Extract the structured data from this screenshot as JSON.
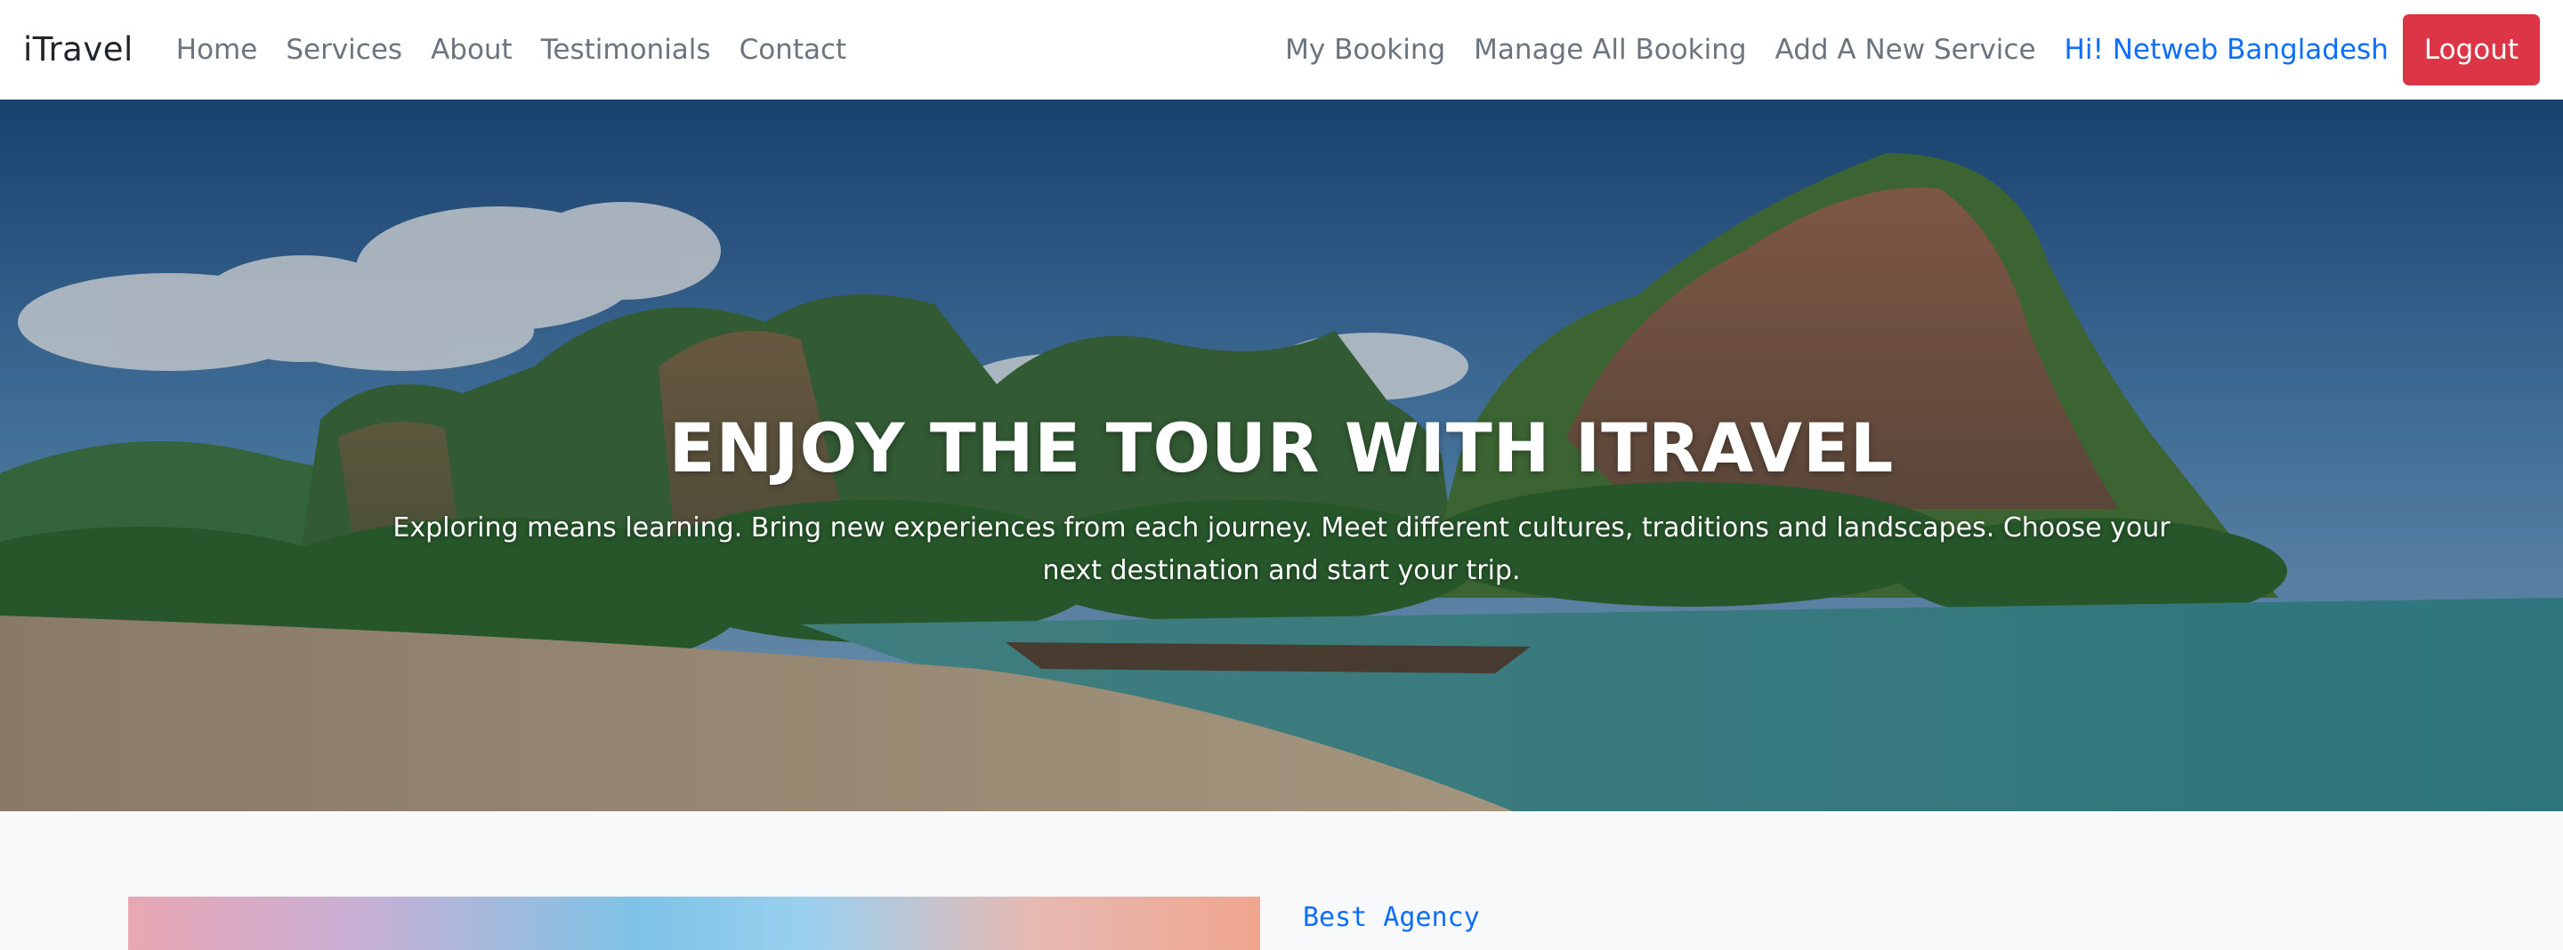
{
  "navbar": {
    "brand": "iTravel",
    "left_links": [
      "Home",
      "Services",
      "About",
      "Testimonials",
      "Contact"
    ],
    "right_links": [
      "My Booking",
      "Manage All Booking",
      "Add A New Service"
    ],
    "greeting": "Hi! Netweb Bangladesh",
    "logout_label": "Logout"
  },
  "hero": {
    "title": "ENJOY THE TOUR WITH ITRAVEL",
    "subtitle": "Exploring means learning. Bring new experiences from each journey. Meet different cultures, traditions and landscapes. Choose your next destination and start your trip."
  },
  "about": {
    "tagline": "Best Agency"
  },
  "colors": {
    "accent": "#0d6efd",
    "logout": "#dc3545",
    "nav_text": "#6c757d"
  }
}
